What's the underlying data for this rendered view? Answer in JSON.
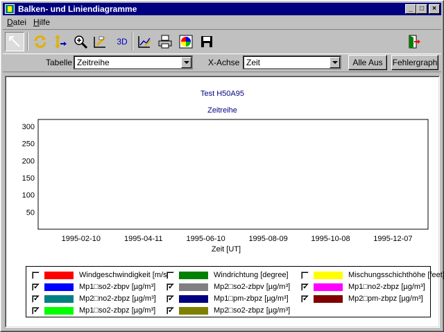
{
  "window": {
    "title": "Balken- und Liniendiagramme"
  },
  "menu": [
    {
      "label": "Datei",
      "accel": "D",
      "rest": "atei"
    },
    {
      "label": "Hilfe",
      "accel": "H",
      "rest": "ilfe"
    }
  ],
  "toolbar": {
    "tools": [
      "pointer-icon",
      "rotate-icon",
      "scale-axis-icon",
      "zoom-icon",
      "edit-icon",
      "3d-icon",
      "chart-edit-icon",
      "print-icon",
      "color-icon",
      "save-icon",
      "exit-icon"
    ],
    "three_d_label": "3D"
  },
  "controls": {
    "tabelle_label": "Tabelle",
    "tabelle_value": "Zeitreihe",
    "xachse_label": "X-Achse",
    "xachse_value": "Zeit",
    "alle_aus": "Alle Aus",
    "fehlergraph": "Fehlergraph"
  },
  "chart_data": {
    "type": "bar",
    "title": "Test H50A95",
    "subtitle": "Zeitreihe",
    "xlabel": "Zeit [UT]",
    "ylabel": "",
    "ylim": [
      0,
      320
    ],
    "yticks": [
      50,
      100,
      150,
      200,
      250,
      300
    ],
    "xticks": [
      "1995-02-10",
      "1995-04-11",
      "1995-06-10",
      "1995-08-09",
      "1995-10-08",
      "1995-12-07"
    ],
    "grid": true,
    "series": [
      {
        "name": "Mp1□so2-zbpz [µg/m³]",
        "color": "#00ff00"
      },
      {
        "name": "Mp2□so2-zbpz [µg/m³]",
        "color": "#808000"
      }
    ]
  },
  "legend": [
    {
      "label": "Windgeschwindigkeit [m/s]",
      "color": "#ff0000",
      "checked": false
    },
    {
      "label": "Windrichtung [degree]",
      "color": "#008000",
      "checked": false
    },
    {
      "label": "Mischungsschichthöhe [feet]",
      "color": "#ffff00",
      "checked": false
    },
    {
      "label": "Mp1□so2-zbpv [µg/m³]",
      "color": "#0000ff",
      "checked": true
    },
    {
      "label": "Mp2□so2-zbpv [µg/m³]",
      "color": "#808080",
      "checked": true
    },
    {
      "label": "Mp1□no2-zbpz [µg/m³]",
      "color": "#ff00ff",
      "checked": true
    },
    {
      "label": "Mp2□no2-zbpz [µg/m³]",
      "color": "#008080",
      "checked": true
    },
    {
      "label": "Mp1□pm-zbpz [µg/m³]",
      "color": "#000080",
      "checked": true
    },
    {
      "label": "Mp2□pm-zbpz [µg/m³]",
      "color": "#800000",
      "checked": true
    },
    {
      "label": "Mp1□so2-zbpz [µg/m³]",
      "color": "#00ff00",
      "checked": true
    },
    {
      "label": "Mp2□so2-zbpz [µg/m³]",
      "color": "#808000",
      "checked": true
    }
  ]
}
